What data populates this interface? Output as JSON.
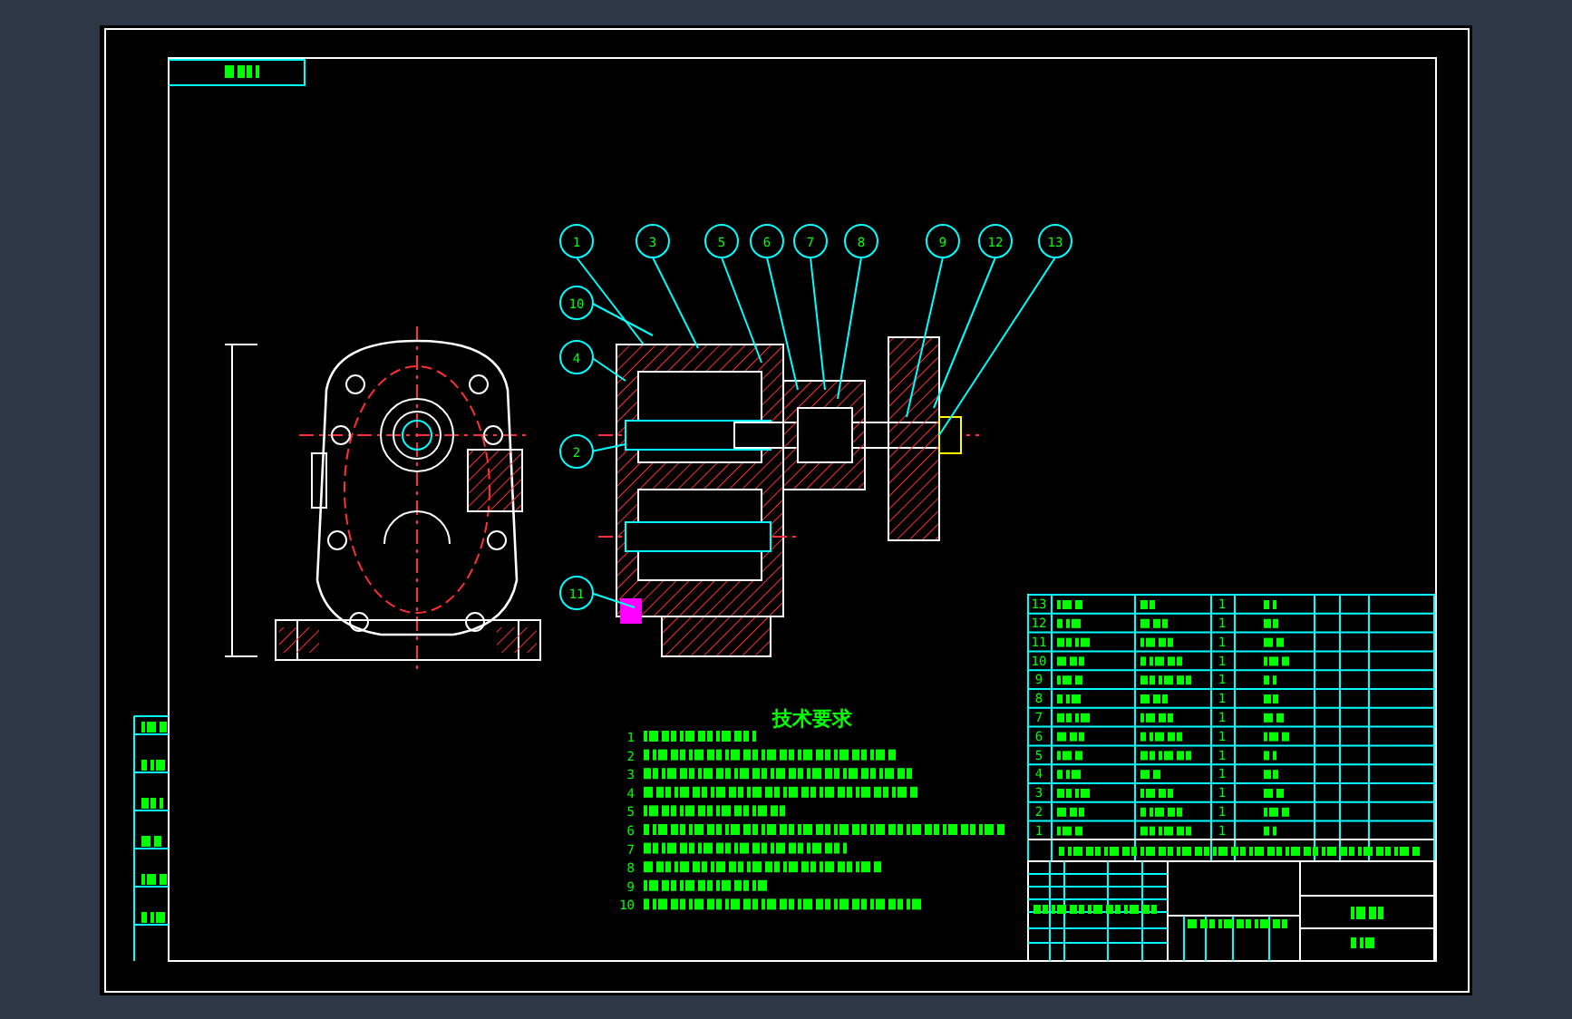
{
  "balloons": [
    {
      "label": "1"
    },
    {
      "label": "3"
    },
    {
      "label": "5"
    },
    {
      "label": "6"
    },
    {
      "label": "7"
    },
    {
      "label": "8"
    },
    {
      "label": "9"
    },
    {
      "label": "12"
    },
    {
      "label": "13"
    },
    {
      "label": "10"
    },
    {
      "label": "4"
    },
    {
      "label": "2"
    },
    {
      "label": "11"
    }
  ],
  "requirements": {
    "heading": "技术要求",
    "items": [
      {
        "number": "1"
      },
      {
        "number": "2"
      },
      {
        "number": "3"
      },
      {
        "number": "4"
      },
      {
        "number": "5"
      },
      {
        "number": "6"
      },
      {
        "number": "7"
      },
      {
        "number": "8"
      },
      {
        "number": "9"
      },
      {
        "number": "10"
      }
    ]
  },
  "bom": {
    "rows": [
      {
        "number": "13",
        "qty": "1"
      },
      {
        "number": "12",
        "qty": "1"
      },
      {
        "number": "11",
        "qty": "1"
      },
      {
        "number": "10",
        "qty": "1"
      },
      {
        "number": "9",
        "qty": "1"
      },
      {
        "number": "8",
        "qty": "1"
      },
      {
        "number": "7",
        "qty": "1"
      },
      {
        "number": "6",
        "qty": "1"
      },
      {
        "number": "5",
        "qty": "1"
      },
      {
        "number": "4",
        "qty": "1"
      },
      {
        "number": "3",
        "qty": "1"
      },
      {
        "number": "2",
        "qty": "1"
      },
      {
        "number": "1",
        "qty": "1"
      }
    ]
  }
}
